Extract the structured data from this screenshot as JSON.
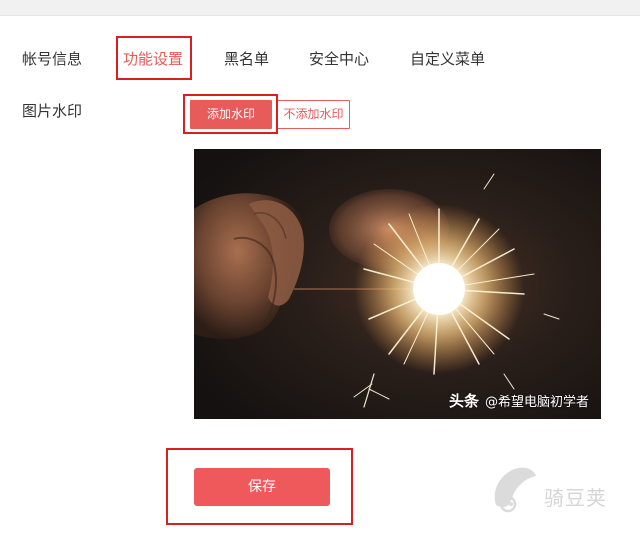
{
  "tabs": [
    {
      "label": "帐号信息"
    },
    {
      "label": "功能设置",
      "active": true
    },
    {
      "label": "黑名单"
    },
    {
      "label": "安全中心"
    },
    {
      "label": "自定义菜单"
    }
  ],
  "watermark_setting": {
    "label": "图片水印",
    "add_label": "添加水印",
    "no_add_label": "不添加水印",
    "selected": "添加水印"
  },
  "preview": {
    "watermark_brand": "头条",
    "watermark_user": "@希望电脑初学者"
  },
  "actions": {
    "save_label": "保存"
  },
  "site_logo": {
    "text": "骑豆荚"
  },
  "colors": {
    "accent": "#e85b5b",
    "highlight": "#d9201f",
    "save_button": "#f0595c"
  }
}
